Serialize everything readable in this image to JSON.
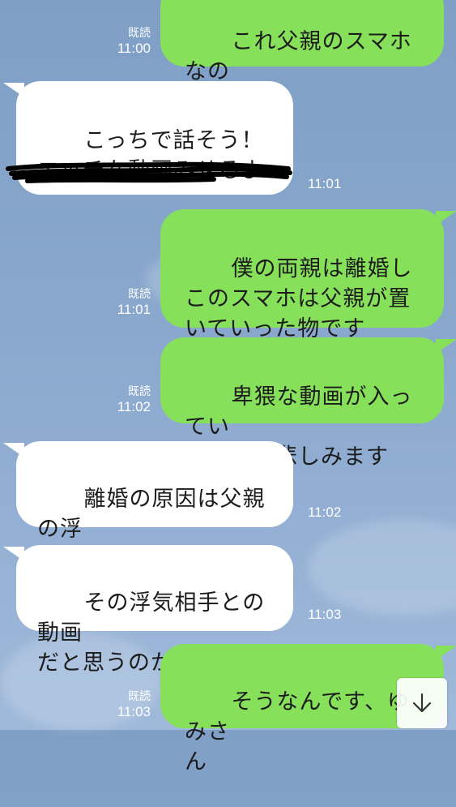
{
  "chat": {
    "messages": [
      {
        "side": "out",
        "text": "これ父親のスマホなの\nで",
        "time": "11:00",
        "read": "既読"
      },
      {
        "side": "in",
        "text": "こっちで話そう！\nエッチな動画みせるよ",
        "time": "11:01"
      },
      {
        "side": "out",
        "text": "僕の両親は離婚し\nこのスマホは父親が置\nいていった物です",
        "time": "11:01",
        "read": "既読"
      },
      {
        "side": "out",
        "text": "卑猥な動画が入ってい\nると母が悲しみます",
        "time": "11:02",
        "read": "既読"
      },
      {
        "side": "in",
        "text": "離婚の原因は父親の浮\n気なのか？",
        "time": "11:02"
      },
      {
        "side": "in",
        "text": "その浮気相手との動画\nだと思うのか？",
        "time": "11:03"
      },
      {
        "side": "out",
        "text": "そうなんです、ゆみさ\nん",
        "time": "11:03",
        "read": "既読"
      }
    ]
  },
  "scroll_button": {
    "icon": "arrow-down-icon"
  }
}
